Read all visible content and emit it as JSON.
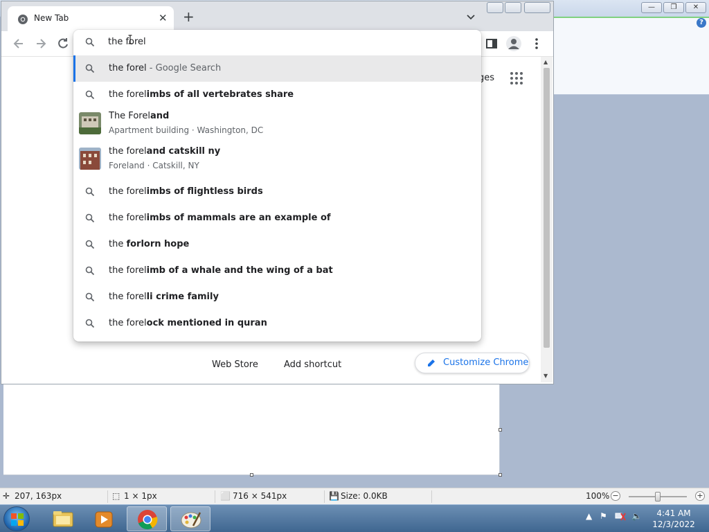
{
  "chrome": {
    "tab_title": "New Tab",
    "omnibox_value": "the forel",
    "gmail_images_partial": "ges",
    "shortcuts": [
      "Web Store",
      "Add shortcut"
    ],
    "customize_label": "Customize Chrome"
  },
  "suggestions": [
    {
      "prefix": "the forel",
      "suffix": "",
      "extra": " - Google Search",
      "selected": true
    },
    {
      "prefix": "the forel",
      "suffix": "imbs of all vertebrates share"
    },
    {
      "prefix": "The Forel",
      "suffix": "and",
      "sub": "Apartment building · Washington, DC",
      "image": "building-photo-1"
    },
    {
      "prefix": "the forel",
      "suffix": "and catskill ny",
      "sub": "Foreland · Catskill, NY",
      "image": "building-photo-2"
    },
    {
      "prefix": "the forel",
      "suffix": "imbs of flightless birds"
    },
    {
      "prefix": "the forel",
      "suffix": "imbs of mammals are an example of"
    },
    {
      "prefix": "the ",
      "suffix": "forlorn hope"
    },
    {
      "prefix": "the forel",
      "suffix": "imb of a whale and the wing of a bat"
    },
    {
      "prefix": "the forel",
      "suffix": "li crime family"
    },
    {
      "prefix": "the forel",
      "suffix": "ock mentioned in quran"
    }
  ],
  "paint": {
    "cursor_pos": "207, 163px",
    "selection_size": "1 × 1px",
    "image_size": "716 × 541px",
    "file_size": "Size: 0.0KB",
    "zoom": "100%"
  },
  "taskbar": {
    "time": "4:41 AM",
    "date": "12/3/2022"
  },
  "colors": {
    "accent": "#1a73e8",
    "selected_row": "#e9e9ea",
    "taskbar": "#3f6690"
  }
}
